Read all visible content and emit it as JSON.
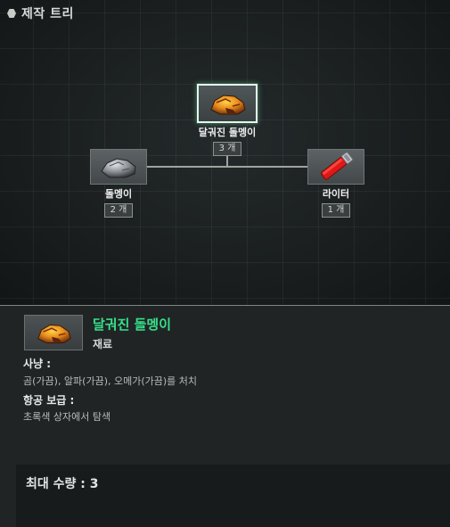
{
  "header": {
    "title": "제작 트리",
    "icon": "hexagon-icon"
  },
  "tree": {
    "root": {
      "name": "달궈진 돌멩이",
      "count": "3 개",
      "icon": "heated-stone-icon",
      "selected": true
    },
    "children": [
      {
        "name": "돌멩이",
        "count": "2 개",
        "icon": "stone-icon"
      },
      {
        "name": "라이터",
        "count": "1 개",
        "icon": "lighter-icon"
      }
    ]
  },
  "detail": {
    "icon": "heated-stone-icon",
    "name": "달궈진 돌멩이",
    "type": "재료",
    "hunt_title": "사냥 :",
    "hunt_text": "곰(가끔), 알파(가끔), 오메가(가끔)를 처치",
    "airdrop_title": "항공 보급 :",
    "airdrop_text": "초록색 상자에서 탐색",
    "max_qty": "최대 수량 : 3"
  },
  "colors": {
    "highlight": "#37e08a",
    "selected_border": "#e8f4ee"
  }
}
